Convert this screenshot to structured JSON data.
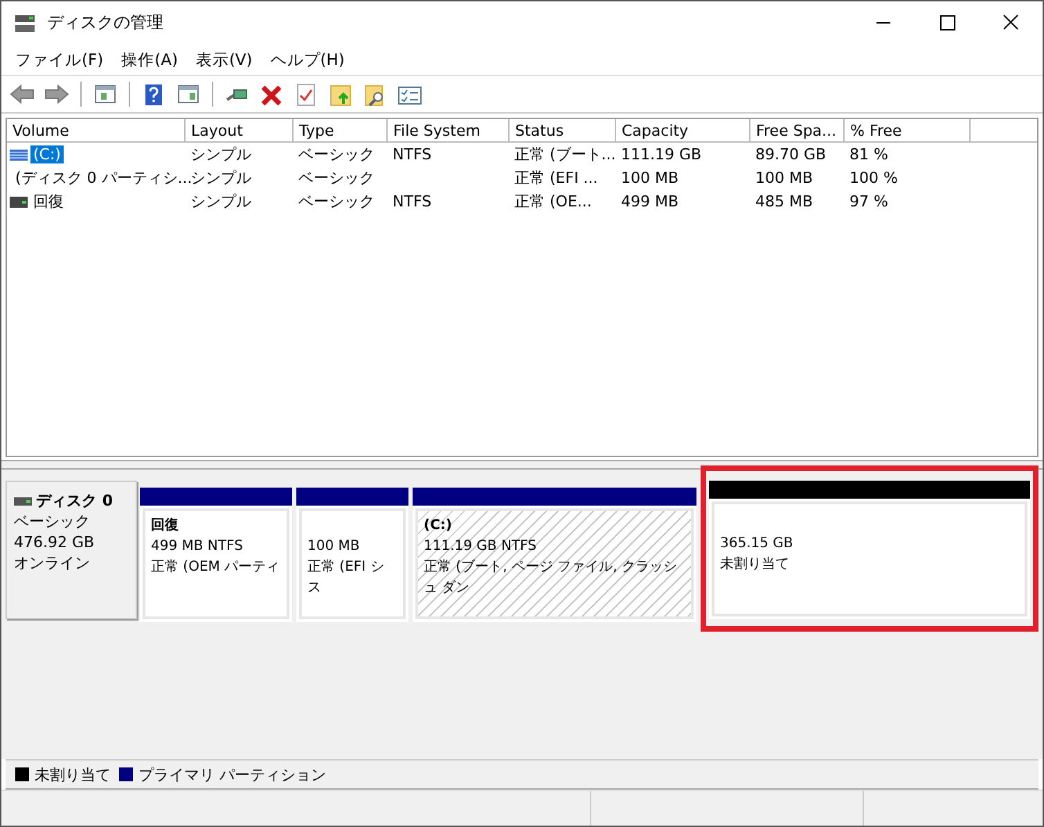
{
  "window": {
    "title": "ディスクの管理"
  },
  "menu": [
    "ファイル(F)",
    "操作(A)",
    "表示(V)",
    "ヘルプ(H)"
  ],
  "volume_table": {
    "columns": [
      "Volume",
      "Layout",
      "Type",
      "File System",
      "Status",
      "Capacity",
      "Free Spa...",
      "% Free"
    ],
    "rows": [
      {
        "cells": [
          "(C:)",
          "シンプル",
          "ベーシック",
          "NTFS",
          "正常 (ブート...",
          "111.19 GB",
          "89.70 GB",
          "81 %"
        ],
        "selected": true,
        "kind": "striped"
      },
      {
        "cells": [
          "(ディスク 0 パーティシ...",
          "シンプル",
          "ベーシック",
          "",
          "正常 (EFI ...",
          "100 MB",
          "100 MB",
          "100 %"
        ],
        "selected": false,
        "kind": "plain"
      },
      {
        "cells": [
          "回復",
          "シンプル",
          "ベーシック",
          "NTFS",
          "正常 (OE...",
          "499 MB",
          "485 MB",
          "97 %"
        ],
        "selected": false,
        "kind": "plain"
      }
    ]
  },
  "disk": {
    "name": "ディスク 0",
    "type": "ベーシック",
    "size": "476.92 GB",
    "state": "オンライン",
    "partitions": [
      {
        "title": "回復",
        "size": "499 MB NTFS",
        "status": "正常 (OEM パーティ",
        "color": "#000080",
        "selected": false,
        "highlighted": false
      },
      {
        "size": "100 MB",
        "status": "正常 (EFI シス",
        "color": "#000080",
        "selected": false,
        "highlighted": false
      },
      {
        "title": "(C:)",
        "size": "111.19 GB NTFS",
        "status": "正常 (ブート, ページ ファイル, クラッシュ ダン",
        "color": "#000080",
        "selected": true,
        "highlighted": false
      },
      {
        "size": "365.15 GB",
        "status": "未割り当て",
        "color": "#000000",
        "selected": false,
        "highlighted": true
      }
    ]
  },
  "legend": [
    {
      "label": "未割り当て",
      "color": "#000000"
    },
    {
      "label": "プライマリ パーティション",
      "color": "#000080"
    }
  ]
}
